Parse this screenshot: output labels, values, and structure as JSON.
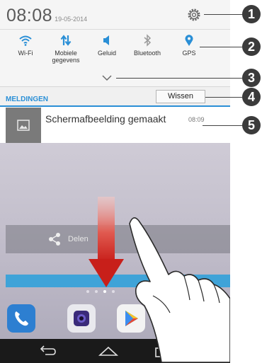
{
  "status": {
    "time": "08:08",
    "date": "19-05-2014"
  },
  "toggles": [
    {
      "label": "Wi-Fi",
      "icon": "wifi-icon"
    },
    {
      "label": "Mobiele gegevens",
      "icon": "mobile-data-icon"
    },
    {
      "label": "Geluid",
      "icon": "sound-icon"
    },
    {
      "label": "Bluetooth",
      "icon": "bluetooth-icon"
    },
    {
      "label": "GPS",
      "icon": "location-pin-icon"
    }
  ],
  "notifications": {
    "section_label": "MELDINGEN",
    "clear_label": "Wissen",
    "items": [
      {
        "title": "Schermafbeelding gemaakt",
        "time": "08:09",
        "icon": "image-icon"
      }
    ]
  },
  "share": {
    "label": "Delen"
  },
  "callouts": [
    "1",
    "2",
    "3",
    "4",
    "5"
  ],
  "colors": {
    "accent": "#2a8fd6",
    "toggle_icon": "#2a8fd6",
    "arrow": "#d02a25",
    "badge": "#3b3b3b"
  }
}
